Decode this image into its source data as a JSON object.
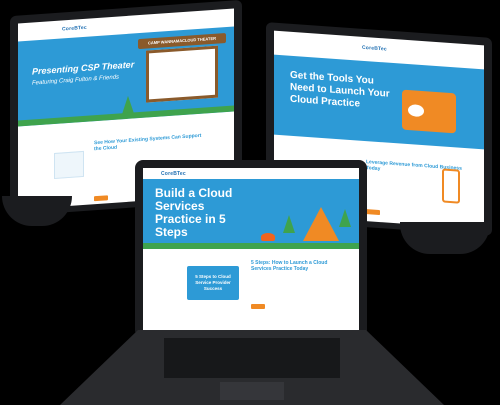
{
  "left_monitor": {
    "logo": "CoreBTec",
    "hero_title": "Presenting CSP Theater",
    "hero_subtitle": "Featuring Craig Fulton & Friends",
    "banner_sign": "CAMP WANNAMACLOUD THEATER",
    "section_heading": "See How Your Existing Systems Can Support the Cloud",
    "accent": "#2d9ad6"
  },
  "right_monitor": {
    "logo": "CoreBTec",
    "hero_title": "Get the Tools You Need to Launch Your Cloud Practice",
    "section_heading": "Leverage Revenue from Cloud Business Today"
  },
  "laptop": {
    "logo": "CoreBTec",
    "hero_title": "Build a Cloud Services Practice in 5 Steps",
    "book_title": "5 Steps to Cloud Service Provider Success",
    "section_heading": "5 Steps: How to Launch a Cloud Services Practice Today"
  },
  "colors": {
    "brand_blue": "#2d9ad6",
    "orange": "#f08a24",
    "tree_green": "#3fa34d",
    "bezel": "#1b1c1f"
  }
}
